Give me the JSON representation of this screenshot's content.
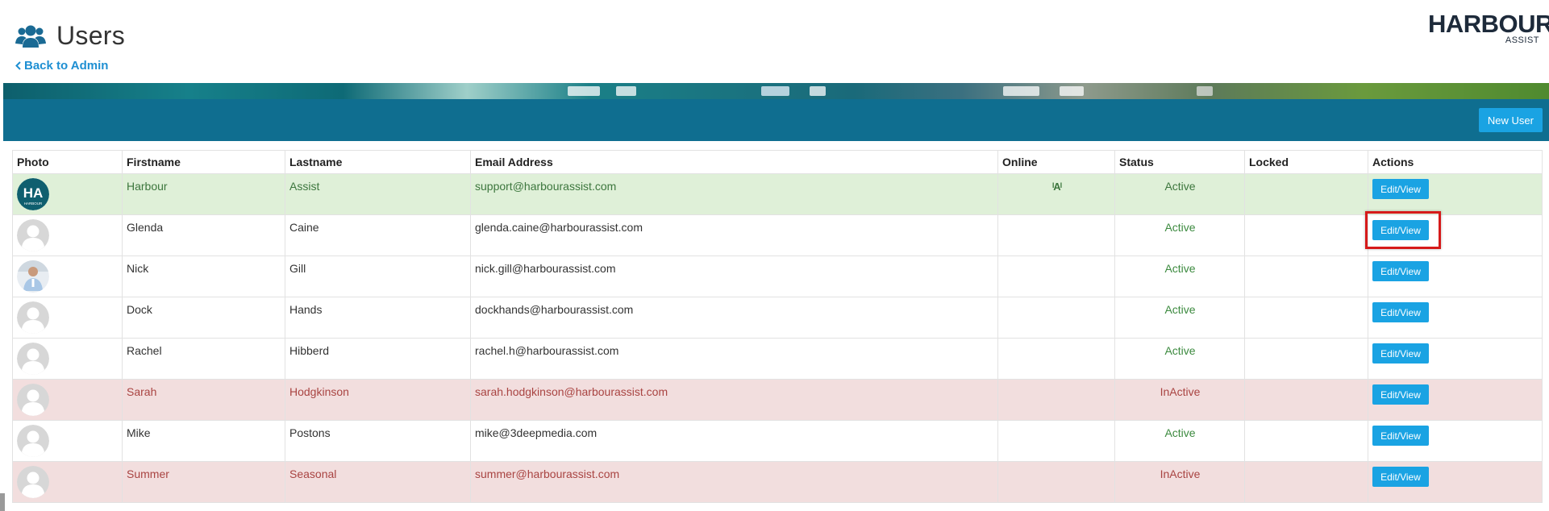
{
  "header": {
    "title": "Users",
    "back_link": "Back to Admin",
    "logo_main": "HARBOUR",
    "logo_sub": "ASSIST"
  },
  "toolbar": {
    "new_user_label": "New User"
  },
  "table": {
    "columns": [
      "Photo",
      "Firstname",
      "Lastname",
      "Email Address",
      "Online",
      "Status",
      "Locked",
      "Actions"
    ],
    "rows": [
      {
        "firstname": "Harbour",
        "lastname": "Assist",
        "email": "support@harbourassist.com",
        "online": "A",
        "status": "Active",
        "locked": "",
        "action": "Edit/View",
        "state": "success",
        "photo": "ha-logo"
      },
      {
        "firstname": "Glenda",
        "lastname": "Caine",
        "email": "glenda.caine@harbourassist.com",
        "online": "",
        "status": "Active",
        "locked": "",
        "action": "Edit/View",
        "state": "normal",
        "photo": "default"
      },
      {
        "firstname": "Nick",
        "lastname": "Gill",
        "email": "nick.gill@harbourassist.com",
        "online": "",
        "status": "Active",
        "locked": "",
        "action": "Edit/View",
        "state": "normal",
        "photo": "person"
      },
      {
        "firstname": "Dock",
        "lastname": "Hands",
        "email": "dockhands@harbourassist.com",
        "online": "",
        "status": "Active",
        "locked": "",
        "action": "Edit/View",
        "state": "normal",
        "photo": "default"
      },
      {
        "firstname": "Rachel",
        "lastname": "Hibberd",
        "email": "rachel.h@harbourassist.com",
        "online": "",
        "status": "Active",
        "locked": "",
        "action": "Edit/View",
        "state": "normal",
        "photo": "default"
      },
      {
        "firstname": "Sarah",
        "lastname": "Hodgkinson",
        "email": "sarah.hodgkinson@harbourassist.com",
        "online": "",
        "status": "InActive",
        "locked": "",
        "action": "Edit/View",
        "state": "danger",
        "photo": "default"
      },
      {
        "firstname": "Mike",
        "lastname": "Postons",
        "email": "mike@3deepmedia.com",
        "online": "",
        "status": "Active",
        "locked": "",
        "action": "Edit/View",
        "state": "normal",
        "photo": "default"
      },
      {
        "firstname": "Summer",
        "lastname": "Seasonal",
        "email": "summer@harbourassist.com",
        "online": "",
        "status": "InActive",
        "locked": "",
        "action": "Edit/View",
        "state": "danger",
        "photo": "default"
      }
    ]
  },
  "colors": {
    "toolbar": "#0f6e90",
    "button": "#1aa3e3",
    "row_success": "#dff0d8",
    "row_danger": "#f2dede",
    "highlight": "#d61a1a"
  },
  "icons": {
    "title": "users-icon",
    "back": "chevron-left-icon",
    "online": "font-a-icon"
  }
}
